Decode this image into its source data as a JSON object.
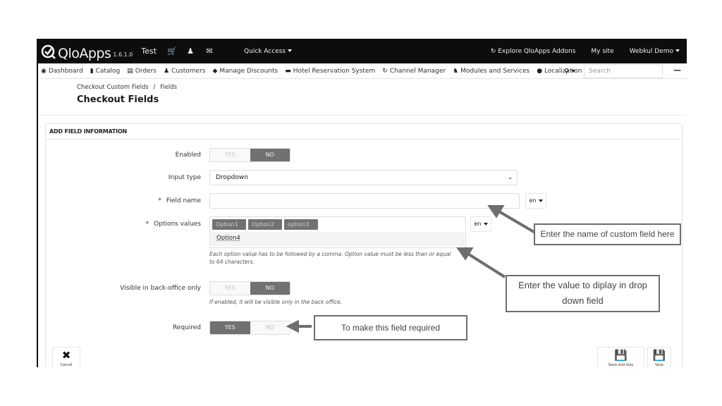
{
  "topbar": {
    "brand": "QloApps",
    "version": "1.6.1.0",
    "shop_name": "Test",
    "icons": [
      "cart-icon",
      "user-icon",
      "envelope-icon"
    ],
    "quick_access": "Quick Access",
    "explore_addons": "Explore QloApps Addons",
    "my_site": "My site",
    "user_menu": "Webkul Demo"
  },
  "nav": {
    "items": [
      {
        "label": "Dashboard",
        "icon": "dashboard-icon"
      },
      {
        "label": "Catalog",
        "icon": "book-icon"
      },
      {
        "label": "Orders",
        "icon": "credit-card-icon"
      },
      {
        "label": "Customers",
        "icon": "users-icon"
      },
      {
        "label": "Manage Discounts",
        "icon": "tag-icon"
      },
      {
        "label": "Hotel Reservation System",
        "icon": "bed-icon"
      },
      {
        "label": "Channel Manager",
        "icon": "refresh-icon"
      },
      {
        "label": "Modules and Services",
        "icon": "puzzle-icon"
      },
      {
        "label": "Localization",
        "icon": "globe-icon"
      }
    ],
    "search_placeholder": "Search",
    "more": "—"
  },
  "header": {
    "breadcrumb": [
      "Checkout Custom Fields",
      "Fields"
    ],
    "breadcrumb_sep": "/",
    "title": "Checkout Fields"
  },
  "panel": {
    "heading": "ADD FIELD INFORMATION",
    "enabled": {
      "label": "Enabled",
      "yes": "YES",
      "no": "NO",
      "value": "NO"
    },
    "input_type": {
      "label": "Input type",
      "value": "Dropdown"
    },
    "field_name": {
      "label": "Field name",
      "required": true,
      "value": "",
      "lang": "en"
    },
    "options_values": {
      "label": "Options values",
      "required": true,
      "tags": [
        "Option1",
        "Option2",
        "option3"
      ],
      "suggestion": "Option4",
      "lang": "en",
      "help": "Each option value has to be followed by a comma.   Option value must be less than or equal to 64 characters."
    },
    "visible_back_office": {
      "label": "Visible in back-office only",
      "yes": "YES",
      "no": "NO",
      "value": "NO",
      "help": "If enabled, it will be visible only in the back office."
    },
    "required": {
      "label": "Required",
      "yes": "YES",
      "no": "NO",
      "value": "YES"
    },
    "req_star": "*"
  },
  "annotations": {
    "field_name": "Enter the name of custom field here",
    "options": "Enter the value to diplay in drop down field",
    "required": "To make this field required"
  },
  "footer": {
    "cancel_label": "Cancel",
    "save_stay_label": "Save and stay",
    "save_label": "Save"
  },
  "colors": {
    "topbar_bg": "#0d0d0d",
    "switch_active": "#717171",
    "annotation_border": "#6e6e6e"
  }
}
